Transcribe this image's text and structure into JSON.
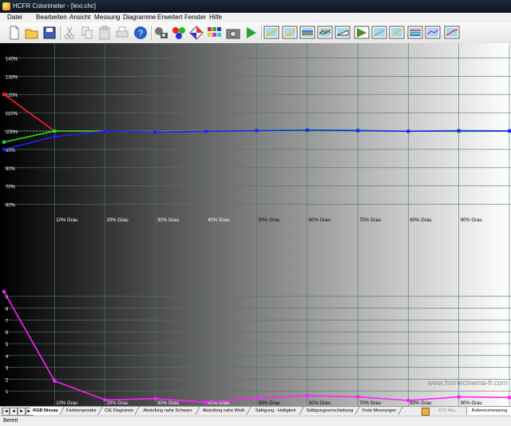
{
  "window": {
    "title": "HCFR Colorimeter - [lexi.chc]"
  },
  "menu": [
    "Datei",
    "Bearbeiten",
    "Ansicht",
    "Messung",
    "Diagramme",
    "Erweitert",
    "Fenster",
    "Hilfe"
  ],
  "toolbar": {
    "icons": [
      "new-file",
      "open-folder",
      "save-disk",
      "cut",
      "copy",
      "paste",
      "print",
      "help",
      "sensor-config",
      "rgb-dots",
      "pattern-generator",
      "color-checker",
      "camera",
      "play",
      "view-luminance",
      "view-gamma",
      "view-rgb-levels",
      "view-color-temp",
      "view-cie",
      "view-saturation",
      "view-near-black",
      "view-near-white",
      "view-measures",
      "view-xyz",
      "view-levels"
    ]
  },
  "chart": {
    "upper_y_ticks": [
      "140%",
      "130%",
      "120%",
      "110%",
      "100%",
      "90%",
      "80%",
      "70%",
      "60%"
    ],
    "lower_y_ticks": [
      "9",
      "8",
      "7",
      "6",
      "5",
      "4",
      "3",
      "2",
      "1"
    ],
    "x_labels": [
      "10% Grau",
      "20% Grau",
      "30% Grau",
      "40% Grau",
      "50% Grau",
      "60% Grau",
      "70% Grau",
      "80% Grau",
      "90% Grau"
    ],
    "watermark": "www.homecinema-fr.com"
  },
  "chart_data": [
    {
      "type": "line",
      "x": [
        0,
        10,
        20,
        30,
        40,
        50,
        60,
        70,
        80,
        90,
        100
      ],
      "ylim": [
        55,
        145
      ],
      "series": [
        {
          "color": "#ff2020",
          "values": [
            120,
            100,
            100,
            null,
            null,
            null,
            null,
            null,
            null,
            null,
            null
          ]
        },
        {
          "color": "#20e020",
          "values": [
            94,
            100,
            100,
            99.5,
            99.8,
            100,
            100,
            100,
            100,
            99.8,
            99.9
          ]
        },
        {
          "color": "#2020ff",
          "values": [
            90,
            97,
            100,
            99.5,
            99.8,
            100.2,
            100.5,
            100.3,
            99.9,
            100.2,
            100.1
          ]
        }
      ]
    },
    {
      "type": "line",
      "x": [
        0,
        10,
        20,
        30,
        40,
        50,
        60,
        70,
        80,
        90,
        100
      ],
      "ylim": [
        0,
        10
      ],
      "series": [
        {
          "color": "#ff20ff",
          "values": [
            9.4,
            1.85,
            0.25,
            0.35,
            0.05,
            0.4,
            0.6,
            0.5,
            0.2,
            0.5,
            0.45
          ]
        }
      ]
    }
  ],
  "tabs": {
    "items": [
      "RGB Niveau",
      "Farbtemperatur",
      "CIE Diagramm",
      "Abstufung nahe Schwarz",
      "Abstufung nahe Weiß",
      "Sättigung - Helligkeit",
      "Sättigungsverschiebung",
      "Freie Messungen"
    ],
    "active": 0,
    "xyz_label": "XYZ Abs.",
    "reference_label": "Referenzmessung"
  },
  "status": {
    "text": "Bereit"
  }
}
